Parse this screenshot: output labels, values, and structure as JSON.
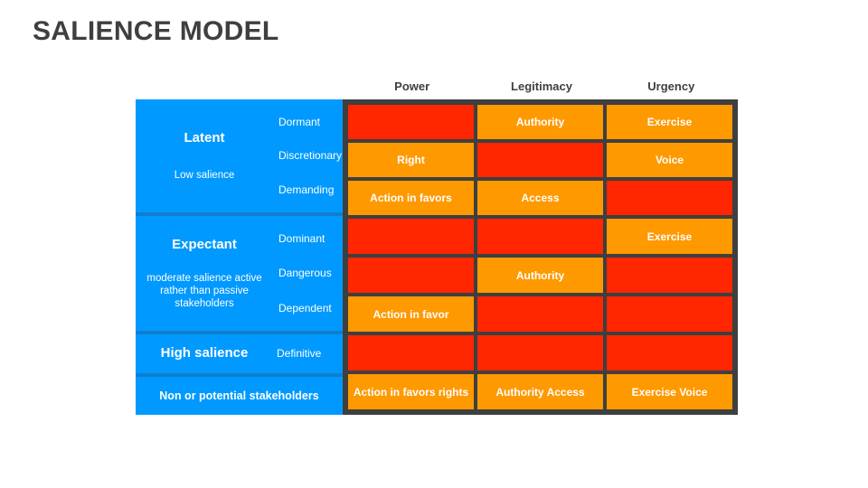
{
  "title": "SALIENCE MODEL",
  "columns": [
    "Power",
    "Legitimacy",
    "Urgency"
  ],
  "groups": [
    {
      "title": "Latent",
      "subtitle": "Low salience",
      "rows": [
        {
          "label": "Dormant",
          "cells": [
            {
              "text": "",
              "color": "red"
            },
            {
              "text": "Authority",
              "color": "orange"
            },
            {
              "text": "Exercise",
              "color": "orange"
            }
          ]
        },
        {
          "label": "Discretionary",
          "cells": [
            {
              "text": "Right",
              "color": "orange"
            },
            {
              "text": "",
              "color": "red"
            },
            {
              "text": "Voice",
              "color": "orange"
            }
          ]
        },
        {
          "label": "Demanding",
          "cells": [
            {
              "text": "Action in favors",
              "color": "orange"
            },
            {
              "text": "Access",
              "color": "orange"
            },
            {
              "text": "",
              "color": "red"
            }
          ]
        }
      ]
    },
    {
      "title": "Expectant",
      "subtitle": "moderate salience active rather than passive stakeholders",
      "rows": [
        {
          "label": "Dominant",
          "cells": [
            {
              "text": "",
              "color": "red"
            },
            {
              "text": "",
              "color": "red"
            },
            {
              "text": "Exercise",
              "color": "orange"
            }
          ]
        },
        {
          "label": "Dangerous",
          "cells": [
            {
              "text": "",
              "color": "red"
            },
            {
              "text": "Authority",
              "color": "orange"
            },
            {
              "text": "",
              "color": "red"
            }
          ]
        },
        {
          "label": "Dependent",
          "cells": [
            {
              "text": "Action in favor",
              "color": "orange"
            },
            {
              "text": "",
              "color": "red"
            },
            {
              "text": "",
              "color": "red"
            }
          ]
        }
      ]
    },
    {
      "title": "High salience",
      "subtitle": "",
      "rows": [
        {
          "label": "Definitive",
          "cells": [
            {
              "text": "",
              "color": "red"
            },
            {
              "text": "",
              "color": "red"
            },
            {
              "text": "",
              "color": "red"
            }
          ]
        }
      ]
    },
    {
      "title": "",
      "subtitle": "Non or potential stakeholders",
      "rows": [
        {
          "label": "",
          "cells": [
            {
              "text": "Action in favors rights",
              "color": "orange"
            },
            {
              "text": "Authority Access",
              "color": "orange"
            },
            {
              "text": "Exercise Voice",
              "color": "orange"
            }
          ]
        }
      ]
    }
  ],
  "colors": {
    "accent_blue": "#0099ff",
    "divider_blue": "#0f7fcc",
    "red": "#ff2600",
    "orange": "#ff9900",
    "border_dark": "#3f3f3f",
    "title_gray": "#3f3f3f"
  }
}
